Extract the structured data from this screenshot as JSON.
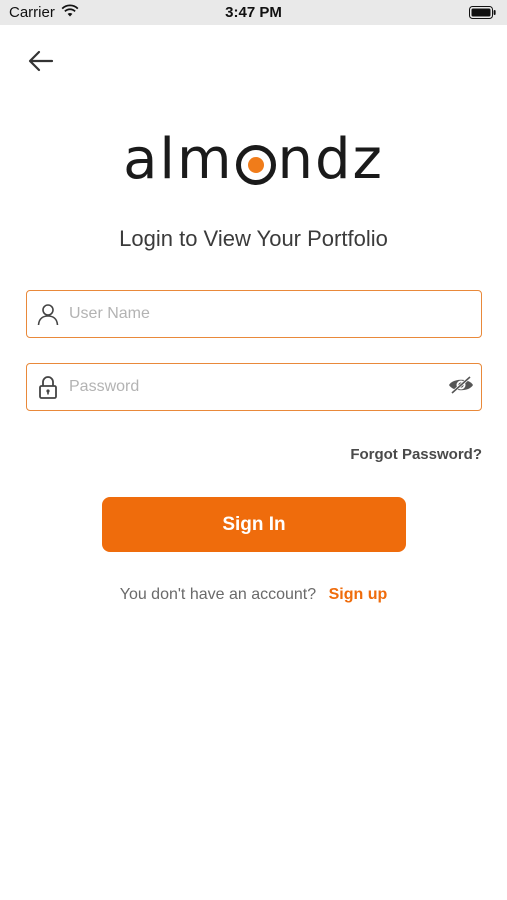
{
  "status_bar": {
    "carrier": "Carrier",
    "time": "3:47 PM"
  },
  "logo": {
    "prefix": "alm",
    "suffix": "ndz",
    "accent_color": "#f07c1a"
  },
  "subtitle": "Login to View Your Portfolio",
  "form": {
    "username_placeholder": "User Name",
    "username_value": "",
    "password_placeholder": "Password",
    "password_value": "",
    "forgot_label": "Forgot Password?",
    "signin_label": "Sign In"
  },
  "signup": {
    "prompt": "You don't have an account?",
    "link": "Sign up"
  },
  "colors": {
    "accent": "#ef6c0c",
    "field_border": "#e9893a"
  },
  "icons": {
    "back": "back-arrow-icon",
    "user": "user-icon",
    "lock": "lock-icon",
    "eye": "eye-slash-icon",
    "wifi": "wifi-icon",
    "battery": "battery-icon"
  }
}
